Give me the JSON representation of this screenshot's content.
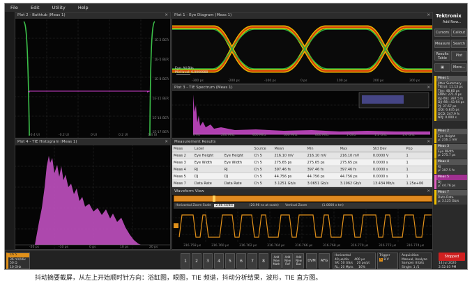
{
  "menu": [
    "File",
    "Edit",
    "Utility",
    "Help"
  ],
  "brand": {
    "name": "Tektronix",
    "add_new": "Add New..."
  },
  "sidebar": {
    "buttons": [
      "Cursors",
      "Callout",
      "Measure",
      "Search",
      "Results Table",
      "Plot",
      "More..."
    ],
    "meas_badges": [
      {
        "title": "Meas 1",
        "lines": [
          "Jitter Summary",
          "TIE(σ): 11.13 ps",
          "TJ@: 48.60 ps",
          "EWAI: 271.4 ps",
          "Rj(-δδ): 397.5 fs",
          "Dj(-δδ): 43.94 ps",
          "PJ: 37.67 ps",
          "DDJ: 6.835 ps",
          "DCD: 247.9 fs",
          "NPJ: 0.000 s"
        ],
        "color": "#f0c000"
      },
      {
        "title": "Meas 2",
        "lines": [
          "Eye Height",
          "μ: 216.1 mV"
        ],
        "color": "#f0c000"
      },
      {
        "title": "Meas 3",
        "lines": [
          "Eye Width",
          "μ: 275.7 ps"
        ],
        "color": "#f0c000"
      },
      {
        "title": "Meas 4",
        "lines": [
          "RJ",
          "μ: 397.5 fs"
        ],
        "color": "#f0c000"
      },
      {
        "title": "Meas 5",
        "lines": [
          "DJ",
          "μ: 44.76 ps"
        ],
        "color": "#e060c0"
      },
      {
        "title": "Meas 7",
        "lines": [
          "Data Rate",
          "μ: 3.125 Gb/s"
        ],
        "color": "#f0c000"
      }
    ]
  },
  "plots": {
    "bathtub": {
      "title": "Plot 2 - Bathtub (Meas 1)",
      "y_ticks": [
        "1E-2 BER",
        "1E-5 BER",
        "1E-8 BER",
        "1E-11 BER",
        "1E-14 BER",
        "1E-17 BER"
      ],
      "x_ticks": [
        "-0.4 UI",
        "-0.2 UI",
        "0 UI",
        "0.2 UI",
        "0.4 UI"
      ]
    },
    "eye": {
      "title": "Plot 1 - Eye Diagram (Meas 1)",
      "label": "Eye: All Bits",
      "sublabel": "Mid level: 0.0000000 ",
      "x_ticks": [
        "-300 ps",
        "-200 ps",
        "-100 ps",
        "0 ps",
        "100 ps",
        "200 ps",
        "300 ps"
      ]
    },
    "tie_spectrum": {
      "title": "Plot 3 - TIE Spectrum (Meas 1)",
      "x_ticks": [
        "0 Hz",
        "200 MHz",
        "400 MHz",
        "600 MHz",
        "800 MHz",
        "1 GHz",
        "1.2 GHz",
        "1.4 GHz"
      ]
    },
    "histogram": {
      "title": "Plot 4 - TIE Histogram (Meas 1)",
      "x_ticks": [
        "-20 ps",
        "-10 ps",
        "0 ps",
        "10 ps",
        "20 ps"
      ]
    },
    "results": {
      "title": "Measurement Results",
      "columns": [
        "Meas",
        "Label",
        "Source",
        "Mean",
        "Min",
        "Max",
        "Std Dev",
        "Pop"
      ],
      "rows": [
        [
          "Meas 2",
          "Eye Height",
          "Eye Height",
          "Ch 5",
          "216.10 mV",
          "216.10 mV",
          "216.10 mV",
          "0.0000 V",
          "1"
        ],
        [
          "Meas 3",
          "Eye Width",
          "Eye Width",
          "Ch 5",
          "275.65 ps",
          "275.65 ps",
          "275.65 ps",
          "0.0000 s",
          "1"
        ],
        [
          "Meas 4",
          "RJ",
          "RJ",
          "Ch 5",
          "397.46 fs",
          "397.46 fs",
          "397.46 fs",
          "0.0000 s",
          "1"
        ],
        [
          "Meas 5",
          "DJ",
          "DJ",
          "Ch 5",
          "44.756 ps",
          "44.756 ps",
          "44.756 ps",
          "0.0000 s",
          "1"
        ],
        [
          "Meas 7",
          "Data Rate",
          "Data Rate",
          "Ch 5",
          "3.1251 Gb/s",
          "3.0651 Gb/s",
          "3.1962 Gb/s",
          "13.434 Mb/s",
          "1.25e+06"
        ]
      ]
    },
    "waveform": {
      "title": "Waveform View",
      "hzoom_label": "Horizontal Zoom Scale",
      "hzoom_value": "2.66 ns/div",
      "hzoom_pos": "(20.96 ns at scale)",
      "vzoom_label": "Vertical Zoom",
      "vzoom_value": "(1.0000 x tm)",
      "x_ticks": [
        "316.758 μs",
        "316.760 μs",
        "316.762 μs",
        "316.764 μs",
        "316.766 μs",
        "316.768 μs",
        "316.770 μs",
        "316.772 μs",
        "316.774 μs"
      ]
    }
  },
  "bottom": {
    "ch5": [
      "Ch 5",
      "36 mV/div",
      "50 Ω",
      "10 GHz"
    ],
    "channels": [
      "1",
      "2",
      "3",
      "4",
      "5",
      "6",
      "7",
      "8"
    ],
    "add_buttons": [
      "Add New Math",
      "Add New Ref",
      "Add New Bus",
      "DVM",
      "AFG"
    ],
    "horizontal": [
      "Horizontal",
      "40 μs/div",
      "400 μs",
      "SR: 50 GS/s",
      "20 ps/pt",
      "RL: 20 Mpts",
      "16%"
    ],
    "trigger": [
      "Trigger",
      "5",
      "8 V"
    ],
    "acquisition": [
      "Acquisition",
      "Manual, Analyze",
      "Sample: 8 bits",
      "Single: 1 /1"
    ],
    "stopped": "Stopped",
    "date": [
      "14 Jul 2020",
      "2:52:03 PM"
    ]
  },
  "caption": "抖动摘要截屏，从左上开始顺时针方向：浴缸图，眼图，TIE 频谱，抖动分析结果，波形，TIE 直方图。"
}
